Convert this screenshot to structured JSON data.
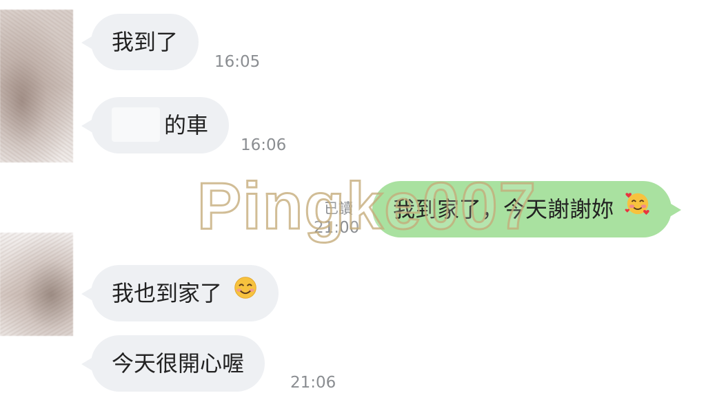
{
  "messages": [
    {
      "side": "in",
      "text": "我到了",
      "time": "16:05"
    },
    {
      "side": "in",
      "text": "的車",
      "time": "16:06",
      "redacted_prefix": true
    },
    {
      "side": "out",
      "text": "我到家了，今天謝謝妳",
      "time": "21:00",
      "status": "已讀",
      "emoji": "smiling-face-with-hearts"
    },
    {
      "side": "in",
      "text": "我也到家了",
      "emoji": "smiling-face"
    },
    {
      "side": "in",
      "text": "今天很開心喔",
      "time": "21:06"
    }
  ],
  "watermark": "Pingke007",
  "colors": {
    "incoming_bubble": "#eef0f3",
    "outgoing_bubble": "#a9e1a0",
    "timestamp": "#8a8d91",
    "watermark_outline": "#c4aa78"
  }
}
